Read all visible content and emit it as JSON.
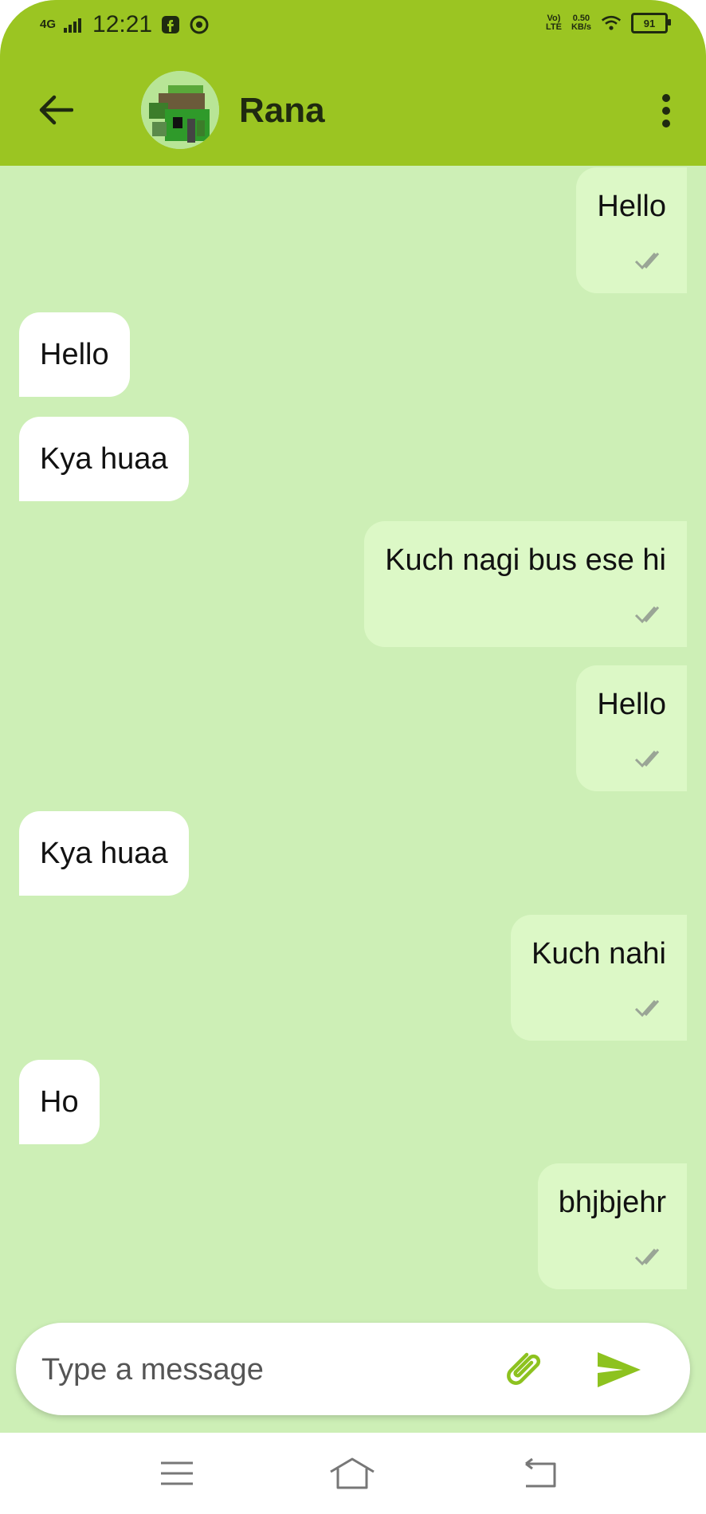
{
  "status_bar": {
    "network": "4G",
    "time": "12:21",
    "volte_top": "Vo)",
    "volte_bottom": "LTE",
    "speed_value": "0.50",
    "speed_unit": "KB/s",
    "battery": "91"
  },
  "header": {
    "contact_name": "Rana"
  },
  "messages": [
    {
      "direction": "outgoing",
      "text": "Hello"
    },
    {
      "direction": "incoming",
      "text": "Hello"
    },
    {
      "direction": "incoming",
      "text": "Kya huaa"
    },
    {
      "direction": "outgoing",
      "text": "Kuch nagi bus ese hi"
    },
    {
      "direction": "outgoing",
      "text": "Hello"
    },
    {
      "direction": "incoming",
      "text": "Kya huaa"
    },
    {
      "direction": "outgoing",
      "text": "Kuch nahi"
    },
    {
      "direction": "incoming",
      "text": "Ho"
    },
    {
      "direction": "outgoing",
      "text": "bhjbjehr"
    }
  ],
  "composer": {
    "placeholder": "Type a message",
    "value": ""
  },
  "colors": {
    "app_bar": "#9bc522",
    "chat_background": "#cdefb6",
    "outgoing_bubble": "#dcf8c6",
    "incoming_bubble": "#ffffff",
    "accent": "#8dc21f"
  },
  "icons": {
    "back": "arrow-left-icon",
    "menu": "more-vertical-icon",
    "attach": "paperclip-icon",
    "send": "send-icon",
    "read_receipt": "double-check-icon",
    "nav_recents": "menu-lines-icon",
    "nav_home": "home-icon",
    "nav_back": "back-arrow-icon"
  }
}
